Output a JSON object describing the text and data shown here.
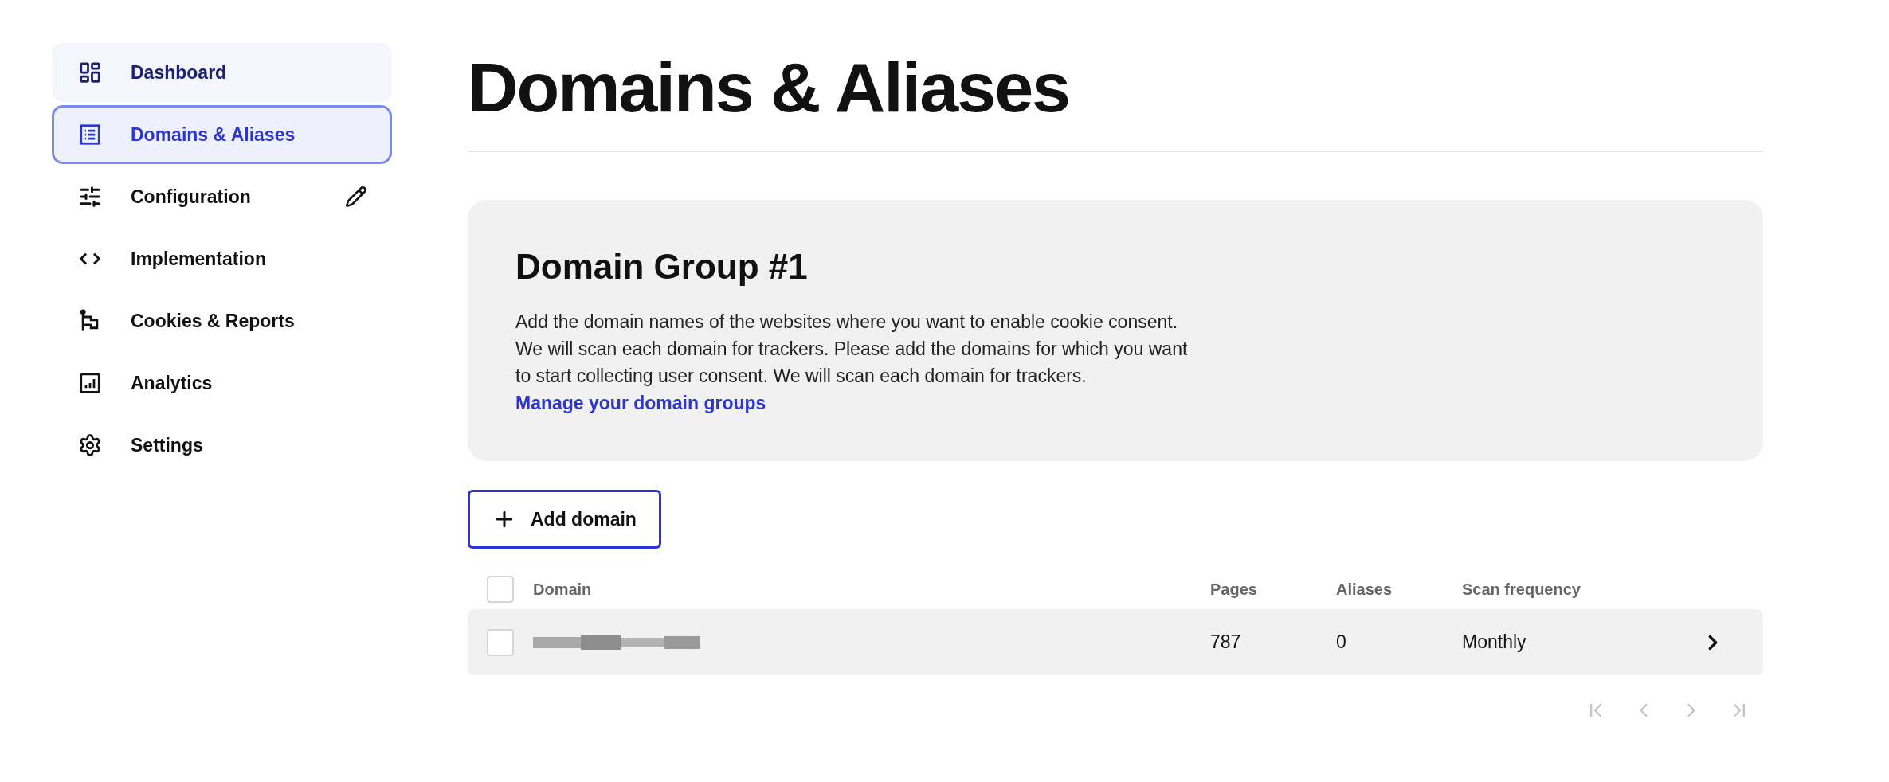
{
  "sidebar": {
    "items": [
      {
        "label": "Dashboard",
        "selected": false,
        "highlighted": true,
        "editable": false
      },
      {
        "label": "Domains & Aliases",
        "selected": true,
        "highlighted": false,
        "editable": false
      },
      {
        "label": "Configuration",
        "selected": false,
        "highlighted": false,
        "editable": true
      },
      {
        "label": "Implementation",
        "selected": false,
        "highlighted": false,
        "editable": false
      },
      {
        "label": "Cookies & Reports",
        "selected": false,
        "highlighted": false,
        "editable": false
      },
      {
        "label": "Analytics",
        "selected": false,
        "highlighted": false,
        "editable": false
      },
      {
        "label": "Settings",
        "selected": false,
        "highlighted": false,
        "editable": false
      }
    ]
  },
  "page_title": "Domains & Aliases",
  "group_card": {
    "title": "Domain Group #1",
    "description": "Add the domain names of the websites where you want to enable cookie consent. We will scan each domain for trackers. Please add the domains for which you want to start collecting user consent. We will scan each domain for trackers.",
    "link": "Manage your domain groups"
  },
  "add_button": "Add domain",
  "table": {
    "select_all_checked": false,
    "columns": [
      "Domain",
      "Pages",
      "Aliases",
      "Scan frequency"
    ],
    "rows": [
      {
        "checked": false,
        "domain_redacted": true,
        "pages": "787",
        "aliases": "0",
        "scan_frequency": "Monthly"
      }
    ]
  },
  "pagination": [
    {
      "kind": "first",
      "disabled": true
    },
    {
      "kind": "prev",
      "disabled": true
    },
    {
      "kind": "next",
      "disabled": true
    },
    {
      "kind": "last",
      "disabled": true
    }
  ]
}
